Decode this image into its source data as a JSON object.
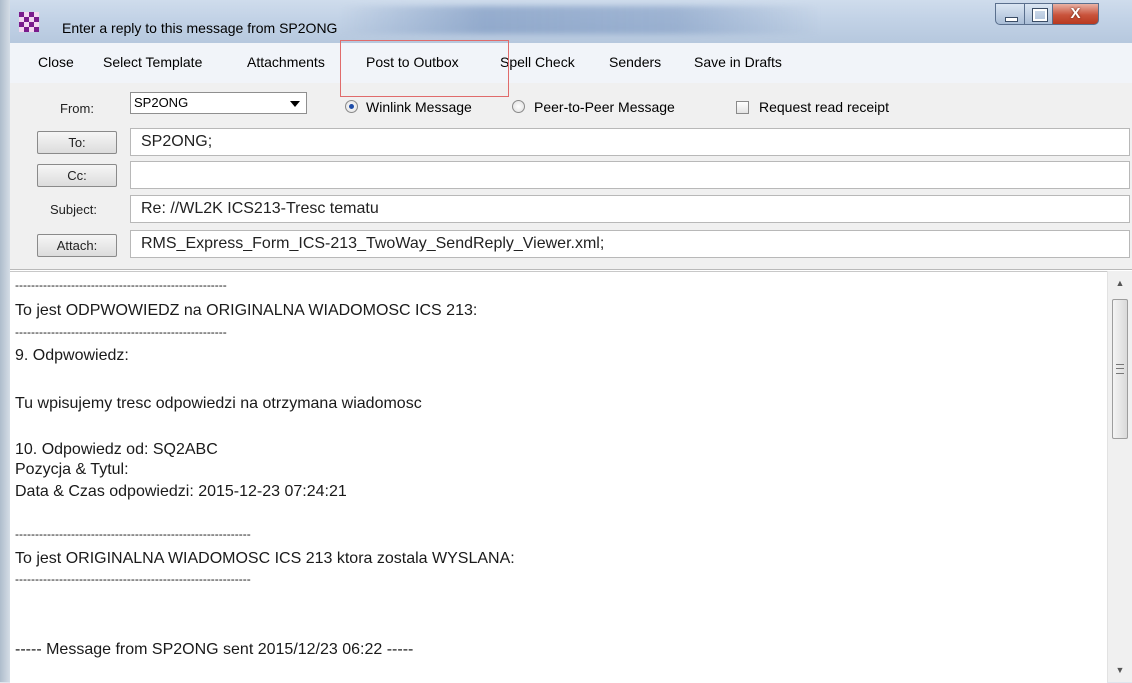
{
  "window": {
    "title": "Enter a reply to this message from SP2ONG",
    "close_glyph": "X"
  },
  "menu": [
    "Close",
    "Select Template",
    "Attachments",
    "Post to Outbox",
    "Spell Check",
    "Senders",
    "Save in Drafts"
  ],
  "form": {
    "from_label": "From:",
    "from_value": "SP2ONG",
    "option_winlink": "Winlink Message",
    "option_p2p": "Peer-to-Peer Message",
    "option_receipt": "Request read receipt",
    "to_button": "To:",
    "to_value": "SP2ONG;",
    "cc_button": "Cc:",
    "cc_value": "",
    "subject_label": "Subject:",
    "subject_value": "Re: //WL2K ICS213-Tresc tematu",
    "attach_button": "Attach:",
    "attach_value": "RMS_Express_Form_ICS-213_TwoWay_SendReply_Viewer.xml;"
  },
  "body_lines": [
    "-----------------------------------------------------",
    "To jest ODPWOWIEDZ na ORIGINALNA WIADOMOSC ICS 213:",
    "-----------------------------------------------------",
    "9. Odpwowiedz:",
    "Tu wpisujemy tresc odpowiedzi na otrzymana wiadomosc",
    "10. Odpowiedz od: SQ2ABC",
    "Pozycja & Tytul:",
    "Data & Czas odpowiedzi: 2015-12-23 07:24:21",
    "-----------------------------------------------------------",
    "To jest ORIGINALNA WIADOMOSC ICS 213 ktora zostala WYSLANA:",
    "-----------------------------------------------------------",
    "----- Message from SP2ONG sent 2015/12/23 06:22 -----"
  ],
  "colors": {
    "highlight_box": "#e06b6b",
    "radio_selected": "#1f4da8"
  }
}
